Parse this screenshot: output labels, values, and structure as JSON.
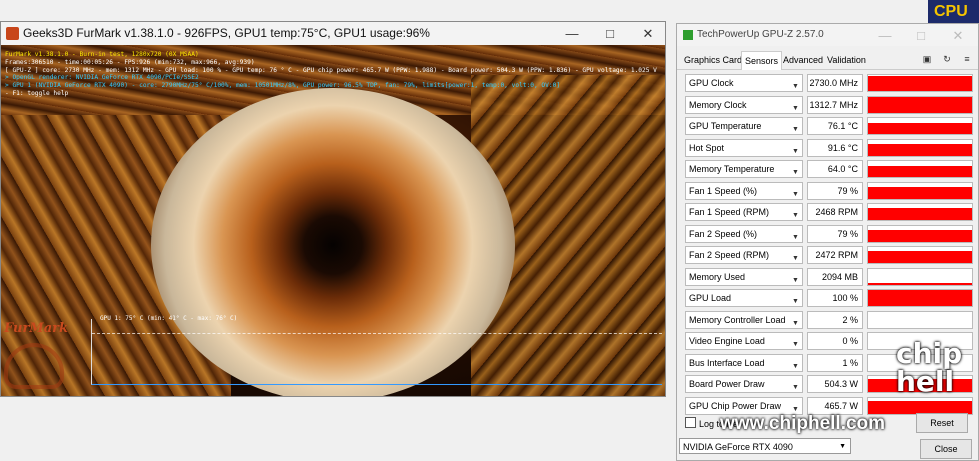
{
  "cpu_badge": "CPU",
  "furmark": {
    "title": "Geeks3D FurMark v1.38.1.0 - 926FPS, GPU1 temp:75°C, GPU1 usage:96%",
    "overlay": [
      {
        "text": "FurMark v1.38.1.0 - Burn-in test, 1280x720 (0X MSAA)",
        "color": "yellow"
      },
      {
        "text": "Frames:306510 - time:00:05:26 - FPS:926 (min:732, max:966, avg:939)",
        "color": "white"
      },
      {
        "text": "[ GPU-Z ] core: 2730 MHz - mem: 1312 MHz - GPU load: 100 % - GPU temp: 76 ° C - GPU chip power: 465.7 W (PPW: 1.988) - Board power: 504.3 W (PPW: 1.836) - GPU voltage: 1.025 V",
        "color": "white"
      },
      {
        "text": "> OpenGL renderer: NVIDIA GeForce RTX 4090/PCIe/SSE2",
        "color": "cyan"
      },
      {
        "text": "> GPU 1 (NVIDIA GeForce RTX 4090) - core: 2790MHz/75° C/100%, mem: 10501MHz/8%, GPU power: 96.5% TDP, fan: 79%, limits[power:1, temp:0, volt:0, OV:0]",
        "color": "cyan"
      },
      {
        "text": "- F1: toggle help",
        "color": "white"
      }
    ],
    "graph_label": "GPU 1: 75° C (min: 41° C - max: 76° C)",
    "logo_text": "FurMark"
  },
  "gpuz": {
    "title": "TechPowerUp GPU-Z 2.57.0",
    "tabs": [
      "Graphics Card",
      "Sensors",
      "Advanced",
      "Validation"
    ],
    "active_tab": "Sensors",
    "sensors": [
      {
        "label": "GPU Clock",
        "value": "2730.0 MHz",
        "level": 0.95
      },
      {
        "label": "Memory Clock",
        "value": "1312.7 MHz",
        "level": 0.95
      },
      {
        "label": "GPU Temperature",
        "value": "76.1 °C",
        "level": 0.7
      },
      {
        "label": "Hot Spot",
        "value": "91.6 °C",
        "level": 0.75
      },
      {
        "label": "Memory Temperature",
        "value": "64.0 °C",
        "level": 0.7
      },
      {
        "label": "Fan 1 Speed (%)",
        "value": "79 %",
        "level": 0.75
      },
      {
        "label": "Fan 1 Speed (RPM)",
        "value": "2468 RPM",
        "level": 0.75
      },
      {
        "label": "Fan 2 Speed (%)",
        "value": "79 %",
        "level": 0.75
      },
      {
        "label": "Fan 2 Speed (RPM)",
        "value": "2472 RPM",
        "level": 0.75
      },
      {
        "label": "Memory Used",
        "value": "2094 MB",
        "level": 0.12
      },
      {
        "label": "GPU Load",
        "value": "100 %",
        "level": 1.0
      },
      {
        "label": "Memory Controller Load",
        "value": "2 %",
        "level": 0.0
      },
      {
        "label": "Video Engine Load",
        "value": "0 %",
        "level": 0.0
      },
      {
        "label": "Bus Interface Load",
        "value": "1 %",
        "level": 0.0
      },
      {
        "label": "Board Power Draw",
        "value": "504.3 W",
        "level": 0.8
      },
      {
        "label": "GPU Chip Power Draw",
        "value": "465.7 W",
        "level": 0.8
      }
    ],
    "log_label": "Log to file",
    "reset_label": "Reset",
    "device": "NVIDIA GeForce RTX 4090",
    "close_label": "Close"
  },
  "watermark": {
    "url": "www.chiphell.com",
    "logo": "chip hell"
  },
  "colors": {
    "graph_red": "#ff0000",
    "cpu_badge_bg": "#1c2a6a",
    "cpu_badge_text": "#f5c400"
  }
}
